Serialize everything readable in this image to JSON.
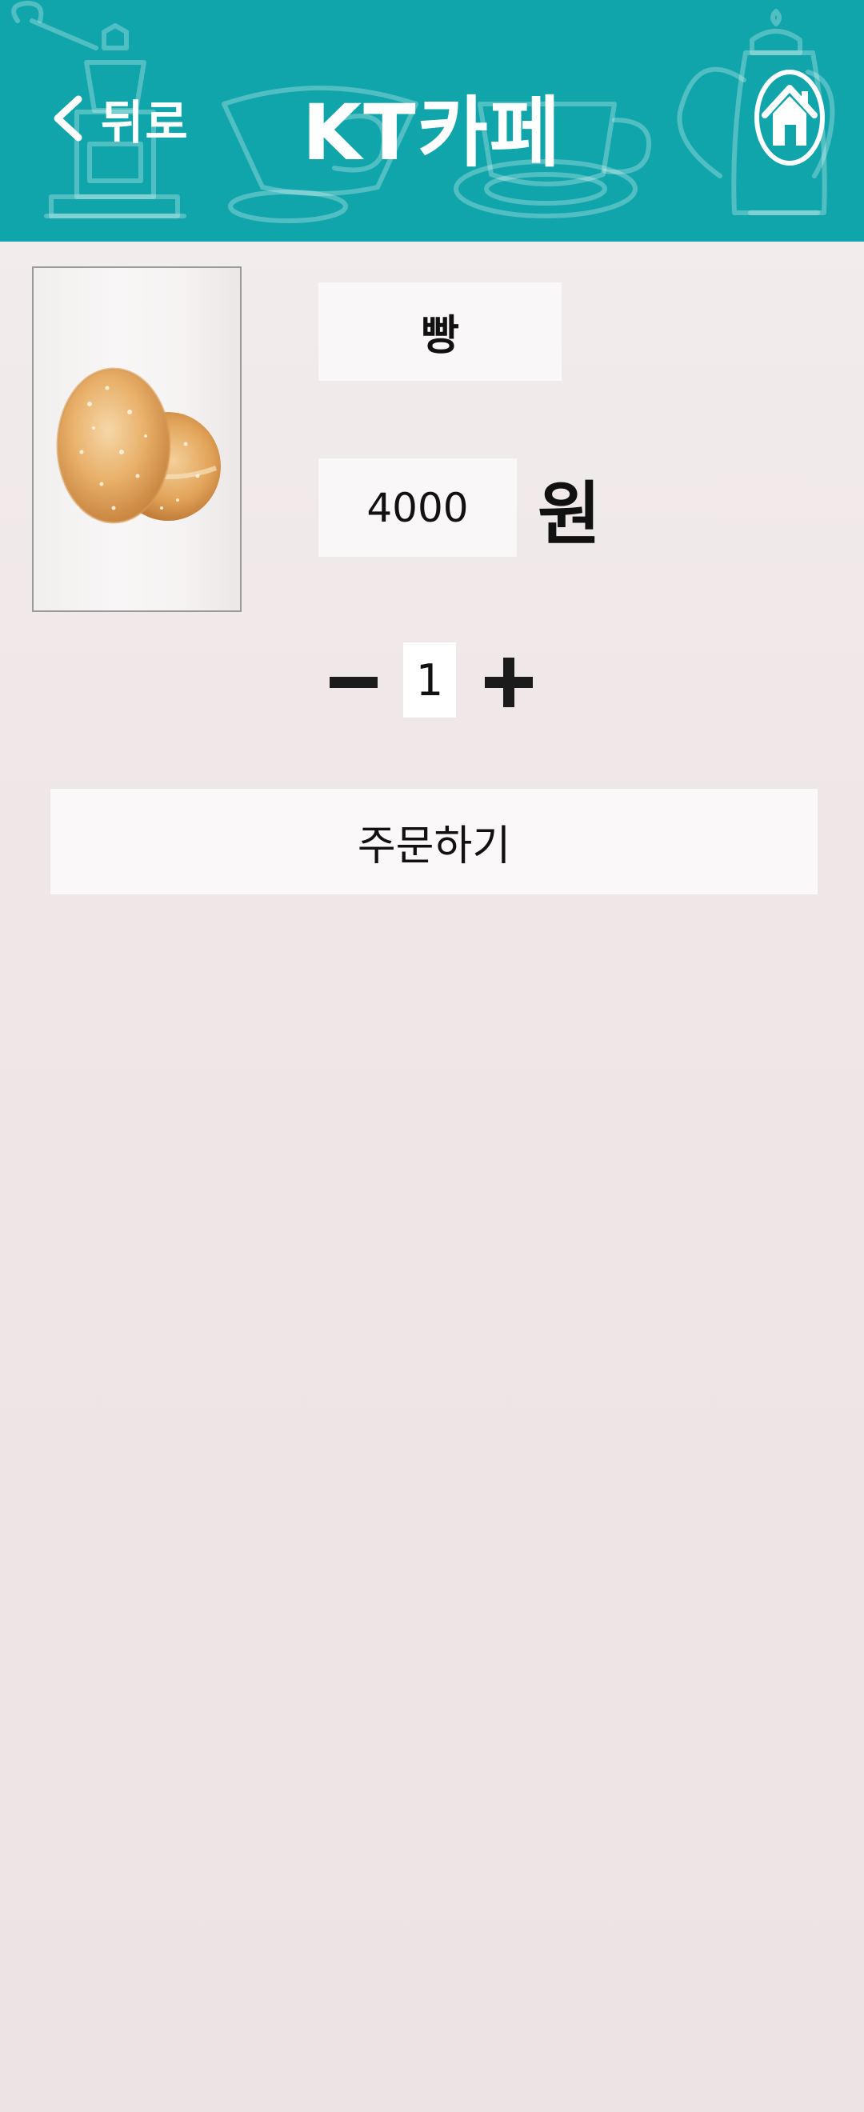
{
  "header": {
    "title": "KT카페",
    "back_label": "뒤로",
    "background_color": "#0fa5ab"
  },
  "product": {
    "image_icon": "donut-image",
    "name": "빵",
    "price": "4000",
    "currency": "원"
  },
  "quantity": {
    "value": "1",
    "minus_icon": "minus-icon",
    "plus_icon": "plus-icon"
  },
  "order_button_label": "주문하기"
}
